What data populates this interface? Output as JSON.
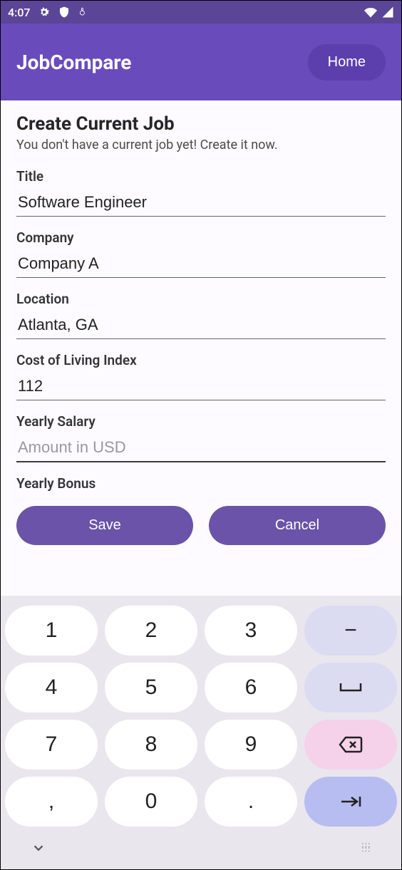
{
  "statusbar": {
    "time": "4:07"
  },
  "appbar": {
    "title": "JobCompare",
    "home_label": "Home"
  },
  "page": {
    "title": "Create Current Job",
    "subtitle": "You don't have a current job yet! Create it now."
  },
  "fields": {
    "title": {
      "label": "Title",
      "value": "Software Engineer"
    },
    "company": {
      "label": "Company",
      "value": "Company A"
    },
    "location": {
      "label": "Location",
      "value": "Atlanta, GA"
    },
    "col_index": {
      "label": "Cost of Living Index",
      "value": "112"
    },
    "salary": {
      "label": "Yearly Salary",
      "value": "",
      "placeholder": "Amount in USD"
    },
    "bonus": {
      "label": "Yearly Bonus"
    }
  },
  "buttons": {
    "save": "Save",
    "cancel": "Cancel"
  },
  "keyboard": {
    "k1": "1",
    "k2": "2",
    "k3": "3",
    "minus": "−",
    "k4": "4",
    "k5": "5",
    "k6": "6",
    "k7": "7",
    "k8": "8",
    "k9": "9",
    "comma": ",",
    "k0": "0",
    "dot": "."
  }
}
